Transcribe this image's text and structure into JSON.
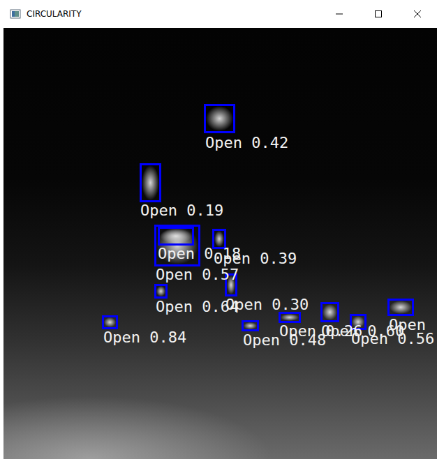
{
  "window": {
    "title": "CIRCULARITY"
  },
  "image": {
    "detections": [
      {
        "label": "Open 0.42"
      },
      {
        "label": "Open 0.19"
      },
      {
        "label": "Open 0.57"
      },
      {
        "label": "Open 0.18"
      },
      {
        "label": "Open 0.39"
      },
      {
        "label": "Open 0.64"
      },
      {
        "label": "Open 0.30"
      },
      {
        "label": "Open 0.84"
      },
      {
        "label": "Open 0.48"
      },
      {
        "label": "Open 0.26"
      },
      {
        "label": "Open 0.60"
      },
      {
        "label": "Open 0.56"
      },
      {
        "label": "Open"
      }
    ]
  }
}
